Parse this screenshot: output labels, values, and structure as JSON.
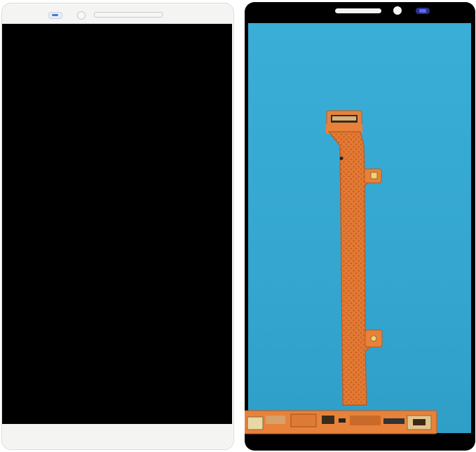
{
  "product": {
    "front": {
      "bezel_color": "#f4f4f2",
      "screen_color": "#000000"
    },
    "back": {
      "lcd_color": "#37a9d2",
      "flex_color": "#e8823a",
      "frame_color": "#000000"
    }
  }
}
